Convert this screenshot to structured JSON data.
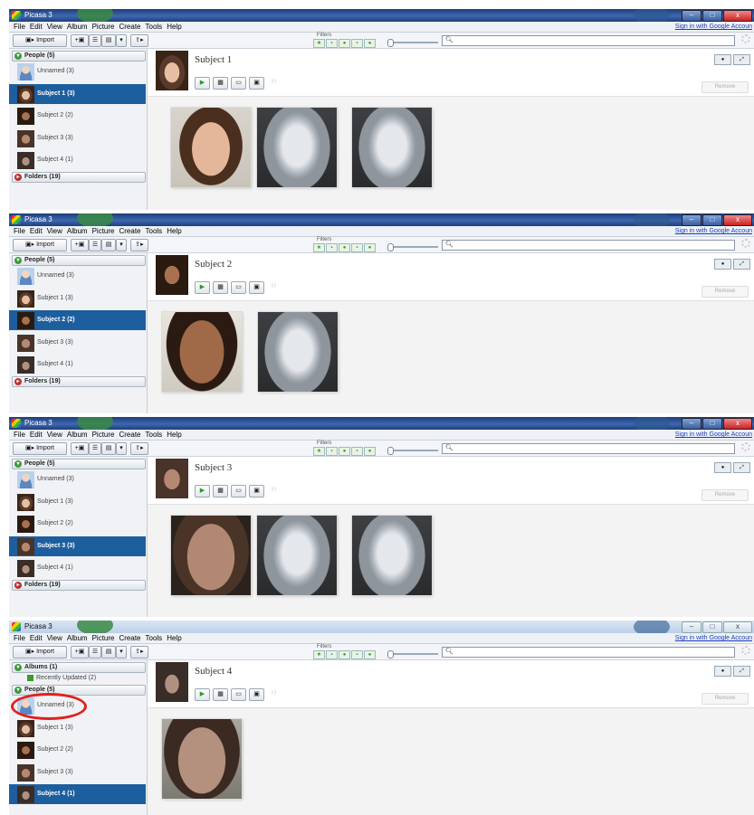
{
  "app": {
    "title": "Picasa 3",
    "menus": [
      "File",
      "Edit",
      "View",
      "Album",
      "Picture",
      "Create",
      "Tools",
      "Help"
    ],
    "signin": "Sign in with Google Accoun",
    "import_label": "Import",
    "filters_label": "Filters",
    "remove_label": "Remove",
    "window_buttons": [
      "–",
      "□",
      "x"
    ]
  },
  "panels": [
    {
      "titlebar_style": "dark",
      "sections": [
        {
          "label": "People (5)",
          "expanded": true
        }
      ],
      "items": [
        {
          "label": "Unnamed (3)",
          "thumb": "generic-avatar",
          "selected": false
        },
        {
          "label": "Subject 1 (3)",
          "thumb": "subject-1",
          "selected": true
        },
        {
          "label": "Subject 2 (2)",
          "thumb": "subject-2",
          "selected": false
        },
        {
          "label": "Subject 3 (3)",
          "thumb": "subject-3",
          "selected": false
        },
        {
          "label": "Subject 4 (1)",
          "thumb": "subject-4",
          "selected": false
        }
      ],
      "folders": "Folders (19)",
      "subject_name": "Subject 1",
      "photos": [
        "photo-subject-1",
        "3d-face-model",
        "3d-face-model"
      ]
    },
    {
      "titlebar_style": "dark",
      "sections": [
        {
          "label": "People (5)",
          "expanded": true
        }
      ],
      "items": [
        {
          "label": "Unnamed (3)",
          "thumb": "generic-avatar",
          "selected": false
        },
        {
          "label": "Subject 1 (3)",
          "thumb": "subject-1",
          "selected": false
        },
        {
          "label": "Subject 2 (2)",
          "thumb": "subject-2",
          "selected": true
        },
        {
          "label": "Subject 3 (3)",
          "thumb": "subject-3",
          "selected": false
        },
        {
          "label": "Subject 4 (1)",
          "thumb": "subject-4",
          "selected": false
        }
      ],
      "folders": "Folders (19)",
      "subject_name": "Subject 2",
      "photos": [
        "photo-subject-2",
        "3d-face-model"
      ]
    },
    {
      "titlebar_style": "dark",
      "sections": [
        {
          "label": "People (5)",
          "expanded": true
        }
      ],
      "items": [
        {
          "label": "Unnamed (3)",
          "thumb": "generic-avatar",
          "selected": false
        },
        {
          "label": "Subject 1 (3)",
          "thumb": "subject-1",
          "selected": false
        },
        {
          "label": "Subject 2 (2)",
          "thumb": "subject-2",
          "selected": false
        },
        {
          "label": "Subject 3 (3)",
          "thumb": "subject-3",
          "selected": true
        },
        {
          "label": "Subject 4 (1)",
          "thumb": "subject-4",
          "selected": false
        }
      ],
      "folders": "Folders (19)",
      "subject_name": "Subject 3",
      "photos": [
        "photo-subject-3",
        "3d-face-model",
        "3d-face-model"
      ]
    },
    {
      "titlebar_style": "light",
      "sections": [
        {
          "label": "Albums (1)",
          "expanded": true
        }
      ],
      "album_item": "Recently Updated (2)",
      "people_section": "People (5)",
      "items": [
        {
          "label": "Unnamed (3)",
          "thumb": "generic-avatar",
          "selected": false
        },
        {
          "label": "Subject 1 (3)",
          "thumb": "subject-1",
          "selected": false
        },
        {
          "label": "Subject 2 (2)",
          "thumb": "subject-2",
          "selected": false
        },
        {
          "label": "Subject 3 (3)",
          "thumb": "subject-3",
          "selected": false
        },
        {
          "label": "Subject 4 (1)",
          "thumb": "subject-4",
          "selected": true
        }
      ],
      "subject_name": "Subject 4",
      "photos": [
        "photo-subject-4"
      ],
      "annotation": "red-ellipse-around-unnamed"
    }
  ],
  "colors": {
    "selection": "#1d5e9e",
    "annotation": "#e02020",
    "link": "#1a3bb8"
  }
}
